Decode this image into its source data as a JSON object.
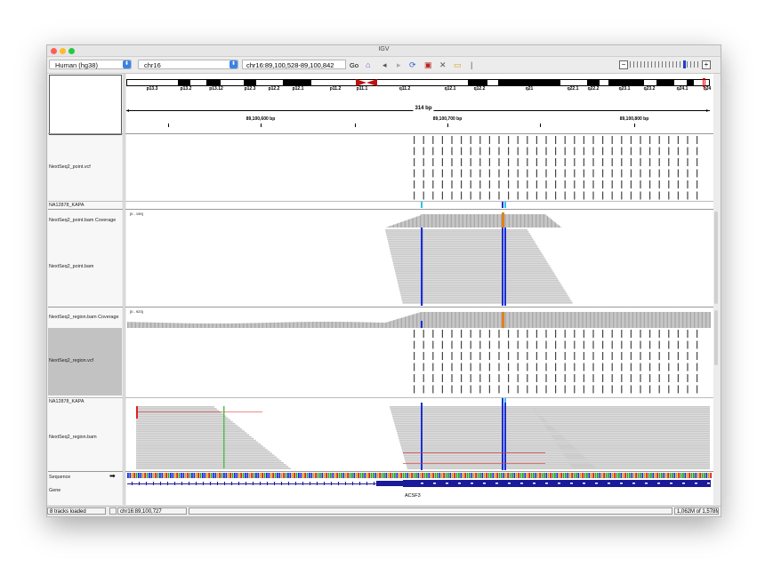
{
  "window": {
    "title": "IGV"
  },
  "toolbar": {
    "genome": "Human (hg38)",
    "chromosome": "chr16",
    "locus": "chr16:89,100,528-89,100,842",
    "go_label": "Go"
  },
  "ideogram": {
    "bands": [
      "p13.3",
      "p13.2",
      "p13.12",
      "p12.3",
      "p12.2",
      "p12.1",
      "p11.2",
      "p11.1",
      "q11.2",
      "q12.1",
      "q12.2",
      "q21",
      "q22.1",
      "q22.2",
      "q23.1",
      "q23.2",
      "q24.1",
      "q24"
    ]
  },
  "ruler": {
    "span": "314 bp",
    "ticks": [
      "89,100,600 bp",
      "89,100,700 bp",
      "89,100,800 bp"
    ]
  },
  "tracks": [
    {
      "name": "NextSeq2_point.vcf"
    },
    {
      "name": "NA12878_KAPA"
    },
    {
      "name": "NextSeq2_point.bam Coverage",
      "range": "[0 - 199]"
    },
    {
      "name": "NextSeq2_point.bam"
    },
    {
      "name": "NextSeq2_region.bam Coverage",
      "range": "[0 - 923]"
    },
    {
      "name": "NextSeq2_region.vcf"
    },
    {
      "name": "NA12878_KAPA"
    },
    {
      "name": "NextSeq2_region.bam"
    },
    {
      "name": "Sequence"
    },
    {
      "name": "Gene"
    }
  ],
  "gene": {
    "label": "ACSF3"
  },
  "status": {
    "tracks_loaded": "8 tracks loaded",
    "position": "chr16:89,100,727",
    "memory": "1,062M of 1,578M"
  },
  "colors": {
    "read": "#c8c8c8",
    "variant_blue": "#1a2fd8",
    "gene": "#1a1a9a",
    "accent": "#3b82e6"
  }
}
